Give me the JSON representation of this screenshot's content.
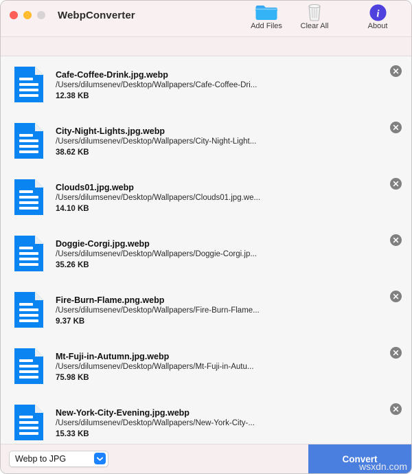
{
  "window": {
    "title": "WebpConverter",
    "traffic_lights": [
      {
        "name": "close",
        "color": "#ff5f57"
      },
      {
        "name": "minimize",
        "color": "#febc2e"
      },
      {
        "name": "zoom",
        "color": "#d8d4d6"
      }
    ]
  },
  "toolbar": {
    "items": [
      {
        "label": "Add Files",
        "icon": "folder-icon"
      },
      {
        "label": "Clear All",
        "icon": "trash-icon"
      },
      {
        "label": "About",
        "icon": "info-icon"
      }
    ]
  },
  "files": [
    {
      "name": "Cafe-Coffee-Drink.jpg.webp",
      "path": "/Users/dilumsenev/Desktop/Wallpapers/Cafe-Coffee-Dri...",
      "size": "12.38 KB",
      "icon": "document-icon",
      "remove": "remove-icon"
    },
    {
      "name": "City-Night-Lights.jpg.webp",
      "path": "/Users/dilumsenev/Desktop/Wallpapers/City-Night-Light...",
      "size": "38.62 KB",
      "icon": "document-icon",
      "remove": "remove-icon"
    },
    {
      "name": "Clouds01.jpg.webp",
      "path": "/Users/dilumsenev/Desktop/Wallpapers/Clouds01.jpg.we...",
      "size": "14.10 KB",
      "icon": "document-icon",
      "remove": "remove-icon"
    },
    {
      "name": "Doggie-Corgi.jpg.webp",
      "path": "/Users/dilumsenev/Desktop/Wallpapers/Doggie-Corgi.jp...",
      "size": "35.26 KB",
      "icon": "document-icon",
      "remove": "remove-icon"
    },
    {
      "name": "Fire-Burn-Flame.png.webp",
      "path": "/Users/dilumsenev/Desktop/Wallpapers/Fire-Burn-Flame...",
      "size": "9.37 KB",
      "icon": "document-icon",
      "remove": "remove-icon"
    },
    {
      "name": "Mt-Fuji-in-Autumn.jpg.webp",
      "path": "/Users/dilumsenev/Desktop/Wallpapers/Mt-Fuji-in-Autu...",
      "size": "75.98 KB",
      "icon": "document-icon",
      "remove": "remove-icon"
    },
    {
      "name": "New-York-City-Evening.jpg.webp",
      "path": "/Users/dilumsenev/Desktop/Wallpapers/New-York-City-...",
      "size": "15.33 KB",
      "icon": "document-icon",
      "remove": "remove-icon"
    }
  ],
  "bottom": {
    "conversion_mode": "Webp to JPG",
    "convert_label": "Convert",
    "dropdown_icon": "chevron-down-icon"
  },
  "watermark": "wsxdn.com",
  "colors": {
    "accent_blue": "#1b82ff",
    "convert_blue": "#4a7fe0",
    "titlebar_pink": "#f9f0f1",
    "list_bg": "#f6f6f6",
    "doc_icon_blue": "#0a84f0"
  }
}
